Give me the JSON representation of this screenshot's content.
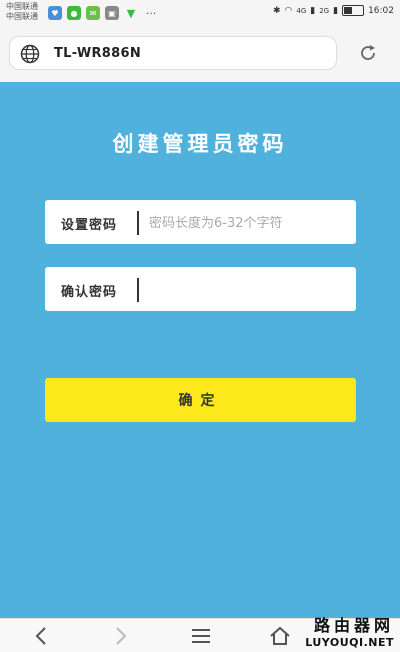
{
  "status_bar": {
    "carrier_1": "中国联通",
    "carrier_2": "中国联通",
    "notification_icons": [
      "app-icon",
      "chat-icon",
      "wechat-icon",
      "gallery-icon",
      "wifi-icon"
    ],
    "more": "···",
    "signal_1": "4G",
    "signal_2": "2G",
    "time": "16:02"
  },
  "browser": {
    "url": "TL-WR886N",
    "reload_icon": "reload-icon",
    "globe_icon": "globe-icon"
  },
  "form": {
    "title": "创建管理员密码",
    "password_label": "设置密码",
    "password_placeholder": "密码长度为6-32个字符",
    "confirm_label": "确认密码",
    "confirm_placeholder": "",
    "submit_label": "确定"
  },
  "nav": {
    "icons": [
      "back-icon",
      "forward-icon",
      "menu-icon",
      "home-icon"
    ]
  },
  "watermark": {
    "cn": "路由器网",
    "en": "LUYOUQI.NET"
  },
  "colors": {
    "background": "#4fb1dc",
    "button": "#fde81c"
  }
}
